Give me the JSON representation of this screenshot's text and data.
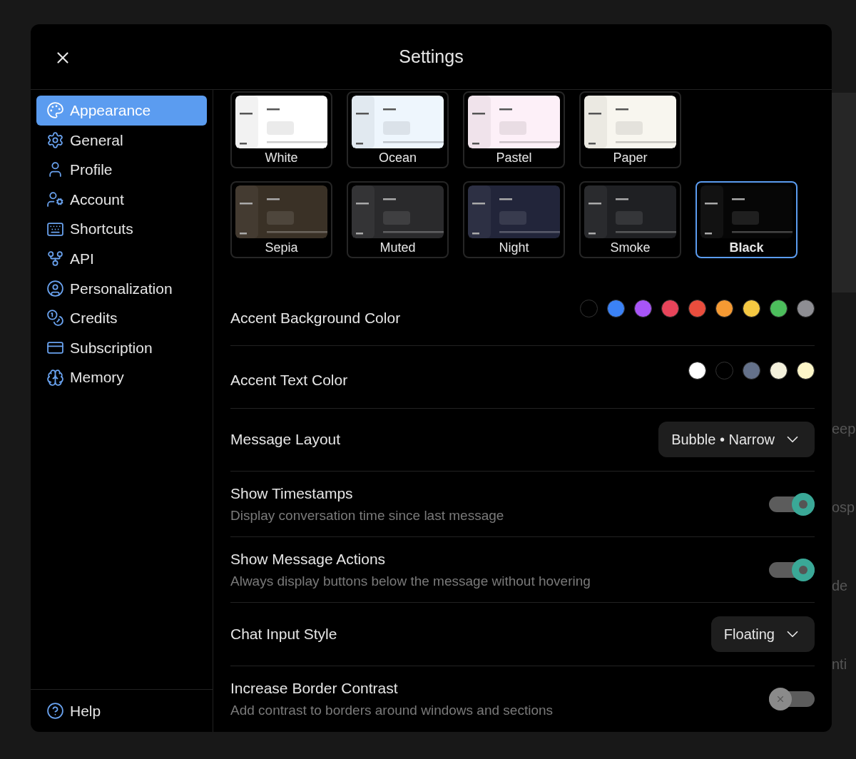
{
  "window": {
    "title": "Settings"
  },
  "sidebar": {
    "items": [
      {
        "label": "Appearance",
        "selected": true
      },
      {
        "label": "General",
        "selected": false
      },
      {
        "label": "Profile",
        "selected": false
      },
      {
        "label": "Account",
        "selected": false
      },
      {
        "label": "Shortcuts",
        "selected": false
      },
      {
        "label": "API",
        "selected": false
      },
      {
        "label": "Personalization",
        "selected": false
      },
      {
        "label": "Credits",
        "selected": false
      },
      {
        "label": "Subscription",
        "selected": false
      },
      {
        "label": "Memory",
        "selected": false
      }
    ],
    "footer": {
      "label": "Help"
    }
  },
  "themes": [
    {
      "name": "White",
      "color": "#ffffff",
      "selected": false
    },
    {
      "name": "Ocean",
      "color": "#eef6fd",
      "selected": false
    },
    {
      "name": "Pastel",
      "color": "#fdf0f8",
      "selected": false
    },
    {
      "name": "Paper",
      "color": "#f8f6ef",
      "selected": false
    },
    {
      "name": "Sepia",
      "color": "#3a3126",
      "selected": false
    },
    {
      "name": "Muted",
      "color": "#2a2a2c",
      "selected": false
    },
    {
      "name": "Night",
      "color": "#22253a",
      "selected": false
    },
    {
      "name": "Smoke",
      "color": "#1f2023",
      "selected": false
    },
    {
      "name": "Black",
      "color": "#060606",
      "selected": true
    }
  ],
  "settings": [
    {
      "kind": "swatches",
      "label": "Accent Background Color",
      "swatches": [
        {
          "color": "#000000"
        },
        {
          "color": "#3b82f6"
        },
        {
          "color": "#a855f7"
        },
        {
          "color": "#e8445a"
        },
        {
          "color": "#ea4d3d"
        },
        {
          "color": "#f59a33"
        },
        {
          "color": "#f5c842"
        },
        {
          "color": "#4cbe5c"
        },
        {
          "color": "#8e8e93"
        }
      ]
    },
    {
      "kind": "swatches",
      "label": "Accent Text Color",
      "swatches": [
        {
          "color": "#ffffff"
        },
        {
          "color": "#000000"
        },
        {
          "color": "#64718a"
        },
        {
          "color": "#f4f1dc"
        },
        {
          "color": "#fdf6c8"
        }
      ]
    },
    {
      "kind": "select",
      "label": "Message Layout",
      "value": "Bubble • Narrow"
    },
    {
      "kind": "toggle",
      "label": "Show Timestamps",
      "description": "Display conversation time since last message",
      "on": true
    },
    {
      "kind": "toggle",
      "label": "Show Message Actions",
      "description": "Always display buttons below the message without hovering",
      "on": true
    },
    {
      "kind": "select",
      "label": "Chat Input Style",
      "value": "Floating"
    },
    {
      "kind": "toggle",
      "label": "Increase Border Contrast",
      "description": "Add contrast to borders around windows and sections",
      "on": false
    }
  ],
  "background_fragments": [
    "eep",
    "osp",
    "de",
    "nti"
  ]
}
